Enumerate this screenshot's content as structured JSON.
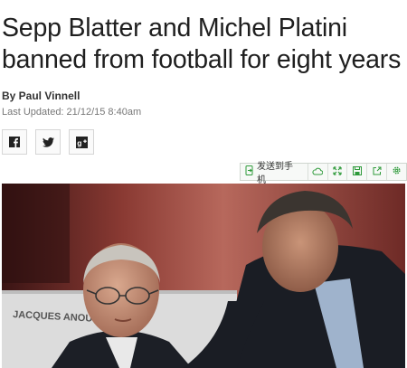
{
  "article": {
    "headline": "Sepp Blatter and Michel Platini banned from football for eight years",
    "byline": "By Paul Vinnell",
    "last_updated": "Last Updated: 21/12/15 8:40am"
  },
  "share": [
    {
      "icon": "facebook-icon"
    },
    {
      "icon": "twitter-icon"
    },
    {
      "icon": "google-plus-icon"
    }
  ],
  "toolbar": {
    "send_label": "发送到手机",
    "icons": [
      "send-to-phone-icon",
      "cloud-icon",
      "expand-icon",
      "save-icon",
      "share-icon",
      "settings-icon"
    ]
  },
  "photo": {
    "nameplate_text": "JACQUES ANOU"
  }
}
